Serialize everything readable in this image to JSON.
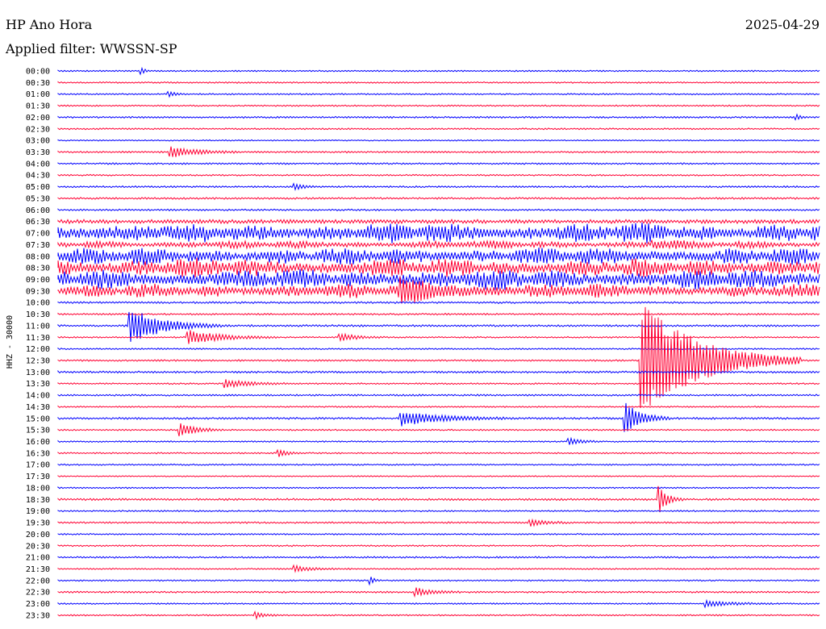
{
  "header": {
    "station": "HP Ano Hora",
    "date": "2025-04-29",
    "filter": "Applied filter: WWSSN-SP"
  },
  "axis": {
    "ylabel": "HHZ - 30000"
  },
  "colors": {
    "blue": "#0000ff",
    "red": "#ff0033",
    "background": "#ffffff",
    "text": "#000000"
  },
  "chart_data": {
    "type": "line",
    "title": "HP Ano Hora",
    "subtitle": "Applied filter: WWSSN-SP",
    "ylabel": "HHZ - 30000",
    "xlabel": "",
    "grid": false,
    "legend": "none",
    "series_colors": [
      "blue",
      "red"
    ],
    "categories": [
      "00:00",
      "00:30",
      "01:00",
      "01:30",
      "02:00",
      "02:30",
      "03:00",
      "03:30",
      "04:00",
      "04:30",
      "05:00",
      "05:30",
      "06:00",
      "06:30",
      "07:00",
      "07:30",
      "08:00",
      "08:30",
      "09:00",
      "09:30",
      "10:00",
      "10:30",
      "11:00",
      "11:30",
      "12:00",
      "12:30",
      "13:00",
      "13:30",
      "14:00",
      "14:30",
      "15:00",
      "15:30",
      "16:00",
      "16:30",
      "17:00",
      "17:30",
      "18:00",
      "18:30",
      "19:00",
      "19:30",
      "20:00",
      "20:30",
      "21:00",
      "21:30",
      "22:00",
      "22:30",
      "23:00",
      "23:30"
    ],
    "noise_level": [
      0.6,
      0.6,
      0.6,
      0.6,
      0.7,
      0.6,
      0.5,
      0.7,
      0.7,
      0.6,
      0.7,
      0.8,
      0.7,
      1.6,
      6.5,
      2.5,
      5.5,
      6,
      6.5,
      4.5,
      0.8,
      0.7,
      0.8,
      0.6,
      0.6,
      0.7,
      0.8,
      0.6,
      0.7,
      0.6,
      0.8,
      0.6,
      0.6,
      0.6,
      0.6,
      0.5,
      0.6,
      0.8,
      0.6,
      0.7,
      0.6,
      0.6,
      0.7,
      0.6,
      0.6,
      0.7,
      0.6,
      0.6
    ],
    "events": [
      {
        "line": "00:00",
        "t": 0.11,
        "amp": 4,
        "dur": 0.005
      },
      {
        "line": "01:00",
        "t": 0.145,
        "amp": 3,
        "dur": 0.01
      },
      {
        "line": "02:00",
        "t": 0.97,
        "amp": 3,
        "dur": 0.006
      },
      {
        "line": "03:30",
        "t": 0.148,
        "amp": 7,
        "dur": 0.03
      },
      {
        "line": "05:00",
        "t": 0.31,
        "amp": 5,
        "dur": 0.01
      },
      {
        "line": "07:30",
        "t": 0.78,
        "amp": 4,
        "dur": 0.02
      },
      {
        "line": "09:30",
        "t": 0.45,
        "amp": 12,
        "dur": 0.05
      },
      {
        "line": "11:00",
        "t": 0.095,
        "amp": 22,
        "dur": 0.04
      },
      {
        "line": "11:30",
        "t": 0.17,
        "amp": 9,
        "dur": 0.04
      },
      {
        "line": "11:30",
        "t": 0.37,
        "amp": 5,
        "dur": 0.02
      },
      {
        "line": "12:30",
        "t": 0.765,
        "amp": 75,
        "dur": 0.07
      },
      {
        "line": "13:30",
        "t": 0.22,
        "amp": 5,
        "dur": 0.03
      },
      {
        "line": "15:00",
        "t": 0.45,
        "amp": 9,
        "dur": 0.05
      },
      {
        "line": "15:00",
        "t": 0.745,
        "amp": 22,
        "dur": 0.02
      },
      {
        "line": "15:30",
        "t": 0.16,
        "amp": 9,
        "dur": 0.02
      },
      {
        "line": "16:00",
        "t": 0.67,
        "amp": 5,
        "dur": 0.015
      },
      {
        "line": "16:30",
        "t": 0.29,
        "amp": 5,
        "dur": 0.01
      },
      {
        "line": "18:30",
        "t": 0.79,
        "amp": 16,
        "dur": 0.01
      },
      {
        "line": "19:30",
        "t": 0.62,
        "amp": 4,
        "dur": 0.02
      },
      {
        "line": "21:30",
        "t": 0.31,
        "amp": 4,
        "dur": 0.02
      },
      {
        "line": "22:00",
        "t": 0.41,
        "amp": 5,
        "dur": 0.005
      },
      {
        "line": "22:30",
        "t": 0.47,
        "amp": 5,
        "dur": 0.02
      },
      {
        "line": "23:00",
        "t": 0.85,
        "amp": 4,
        "dur": 0.03
      },
      {
        "line": "23:30",
        "t": 0.26,
        "amp": 4,
        "dur": 0.01
      }
    ]
  }
}
